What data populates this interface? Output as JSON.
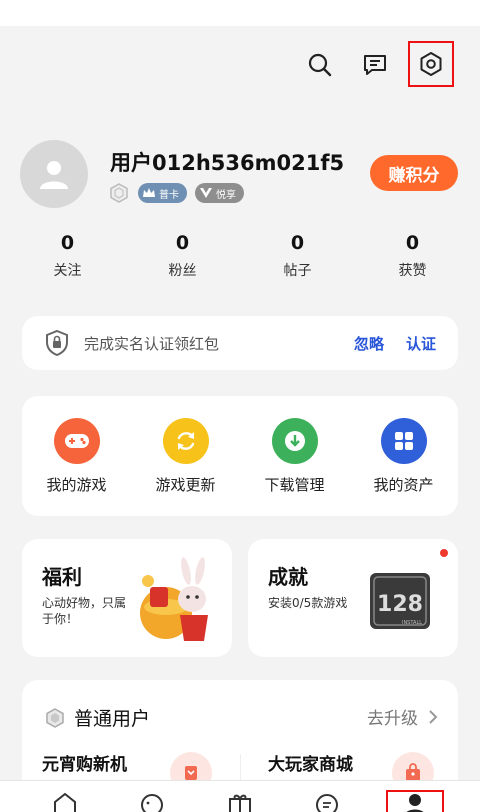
{
  "profile": {
    "username": "用户012h536m021f5",
    "badge_card": "普卡",
    "badge_vip": "悦享",
    "earn_points_label": "赚积分"
  },
  "stats": [
    {
      "value": "0",
      "label": "关注"
    },
    {
      "value": "0",
      "label": "粉丝"
    },
    {
      "value": "0",
      "label": "帖子"
    },
    {
      "value": "0",
      "label": "获赞"
    }
  ],
  "verify": {
    "text": "完成实名认证领红包",
    "ignore_label": "忽略",
    "verify_label": "认证"
  },
  "tools": [
    {
      "label": "我的游戏",
      "color": "#f5643a",
      "icon": "gamepad-icon"
    },
    {
      "label": "游戏更新",
      "color": "#f7c219",
      "icon": "refresh-icon"
    },
    {
      "label": "下载管理",
      "color": "#3cb05a",
      "icon": "download-icon"
    },
    {
      "label": "我的资产",
      "color": "#2f5fd9",
      "icon": "grid-icon"
    }
  ],
  "welfare": {
    "title": "福利",
    "subtitle": "心动好物，只属于你！"
  },
  "achievement": {
    "title": "成就",
    "subtitle": "安装0/5款游戏",
    "install_art_label": "INSTALL"
  },
  "member": {
    "title": "普通用户",
    "upgrade_label": "去升级",
    "shop_left": "元宵购新机",
    "shop_right": "大玩家商城"
  },
  "colors": {
    "accent_orange": "#ff6a2c",
    "link_blue": "#2a56d8",
    "highlight_red": "#e11111"
  }
}
